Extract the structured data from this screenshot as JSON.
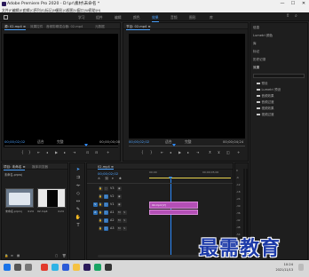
{
  "window": {
    "title": "Adobe Premiere Pro 2020 - D:\\pr\\素材\\未命名 *",
    "controls": [
      "—",
      "☐",
      "✕"
    ]
  },
  "menu": [
    "文件(F)",
    "编辑(E)",
    "剪辑(C)",
    "序列(S)",
    "标记(M)",
    "图形(G)",
    "视图(V)",
    "窗口(W)",
    "帮助(H)"
  ],
  "workspaces": {
    "items": [
      "学习",
      "组件",
      "编辑",
      "颜色",
      "效果",
      "音频",
      "图形",
      "库"
    ],
    "active": "效果"
  },
  "source_monitor": {
    "tabs": [
      "源: 02.mp4 ≡",
      "效果控件",
      "音频剪辑混合器: 02.mp4",
      "元数据"
    ],
    "timecode_left": "00;00;02;02",
    "fit": "适合",
    "ratio": "完整",
    "timecode_right": "00;00;00;00"
  },
  "program_monitor": {
    "tab": "节目: 02.mp4 ≡",
    "timecode_left": "00;00;02;02",
    "fit": "适合",
    "ratio": "完整",
    "timecode_right": "00;00;04;24"
  },
  "effects_panel": {
    "sections": [
      "信息",
      "Lumetri 颜色",
      "库",
      "标记",
      "历史记录",
      "效果"
    ],
    "search_placeholder": "",
    "items": [
      "预设",
      "Lumetri 预设",
      "音频效果",
      "音频过渡",
      "视频效果",
      "视频过渡"
    ]
  },
  "project": {
    "tabs": [
      "项目: 未命名 ≡",
      "媒体浏览器"
    ],
    "name": "未命名.prproj",
    "items": [
      {
        "label": "未命名.prproj",
        "duration": "4:24"
      },
      {
        "label": "02.mp4",
        "duration": "4:24"
      }
    ]
  },
  "timeline": {
    "tab": "02.mp4 ≡",
    "timecode": "00;00;02;02",
    "ruler_labels": [
      "00;00",
      "00;00;05;00"
    ],
    "tracks": [
      {
        "name": "V3"
      },
      {
        "name": "V2"
      },
      {
        "name": "V1"
      },
      {
        "name": "A1"
      },
      {
        "name": "A2"
      },
      {
        "name": "A3"
      }
    ],
    "clips": [
      {
        "label": "02.mp4 [V]",
        "track": "V1"
      },
      {
        "label": "",
        "track": "A1"
      }
    ]
  },
  "meters": {
    "labels": [
      "0",
      "-6",
      "-12",
      "-18",
      "-24",
      "-30",
      "-36",
      "-42",
      "-48",
      "-54",
      "dB"
    ],
    "solo": "S",
    "mute": "S"
  },
  "taskbar": {
    "time": "10:24",
    "date": "2021/11/13"
  },
  "watermark": "最需教育",
  "colors": {
    "accent": "#4da3ff",
    "clip": "#b44fb6",
    "watermark": "#1c3aa8"
  }
}
